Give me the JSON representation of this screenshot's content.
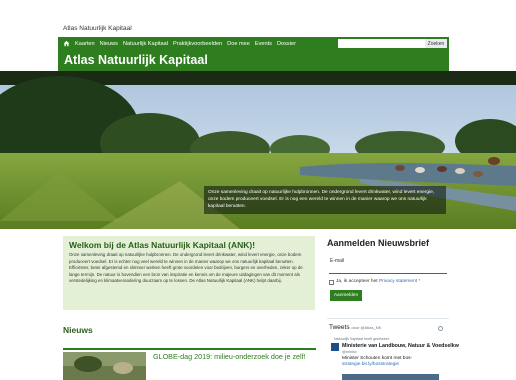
{
  "site": {
    "name": "Atlas Natuurlijk Kapitaal"
  },
  "nav": {
    "items": [
      "Kaarten",
      "Nieuws",
      "Natuurlijk Kapitaal",
      "Praktijkvoorbeelden",
      "Doe mee",
      "Events",
      "Dossier"
    ],
    "search_placeholder": "",
    "search_button": "Zoeken",
    "home_icon": "home-icon"
  },
  "page": {
    "title": "Atlas Natuurlijk Kapitaal"
  },
  "hero": {
    "caption": "Onze samenleving draait op natuurlijke hulpbronnen. De ondergrond levert drinkwater, wind levert energie, onze bodem produceert voedsel. Er is nog een wereld te winnen in de manier waarop we ons natuurlijk kapitaal benutten."
  },
  "welcome": {
    "title": "Welkom bij de Atlas Natuurlijk Kapitaal (ANK)!",
    "body": "Onze samenleving draait op natuurlijke hulpbronnen. De ondergrond levert drinkwater, wind levert energie, onze bodem produceert voedsel. Er is echter nog veel wereld te winnen in de manier waarop we ons natuurlijk kapitaal benutten. Efficiënter, beter afgestemd en slimmer werken heeft grote voordelen voor bedrijven, burgers en overheden, zeker op de lange termijn. De natuur is bovendien een bron van inspiratie en kennis om de majeure uitdagingen van dit moment als verstedelijking en klimaatverandering duurzaam op te lossen. De Atlas Natuurlijk Kapitaal (ANK) helpt daarbij."
  },
  "news": {
    "heading": "Nieuws",
    "items": [
      {
        "title": "GLOBE-dag 2019: milieu-onderzoek doe je zelf!"
      }
    ]
  },
  "newsletter": {
    "title": "Aanmelden Nieuwsbrief",
    "email_label": "E-mail",
    "consent_prefix": "Ja, ik accepteer het",
    "consent_link": "Privacy statement",
    "consent_required": "*",
    "button": "Aanmelden"
  },
  "tweets": {
    "heading": "Tweets",
    "by": "door @Atlas_NK",
    "retweet_note": "Natuurlijk Kapitaal heeft geretweet",
    "author": "Ministerie van Landbouw, Natuur & Voedselkw",
    "handle": "@minlnv",
    "text_prefix": "Minister Schouten komt met bos-",
    "text_link": "strategie.bit.ly/bosstrategie",
    "info_icon": "info-icon"
  },
  "colors": {
    "brand_green": "#2e7d1f",
    "light_green": "#e4f0d6",
    "link_blue": "#2e6fb5"
  }
}
